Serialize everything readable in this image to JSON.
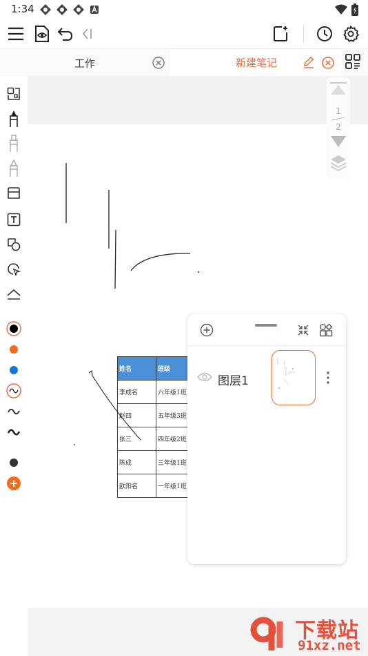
{
  "status_bar": {
    "time": "1:34"
  },
  "tabs": [
    {
      "label": "工作",
      "active": false
    },
    {
      "label": "新建笔记",
      "active": true
    }
  ],
  "colors": {
    "accent": "#e8693a",
    "palette": [
      "#000000",
      "#f46b1c",
      "#1577d4",
      "#000000",
      "#000000",
      "#333333"
    ],
    "table_header": "#4a90d9"
  },
  "page_nav": {
    "current": "1",
    "total": "2"
  },
  "table": {
    "headers": [
      "姓名",
      "班级"
    ],
    "rows": [
      [
        "李成名",
        "六年级1班"
      ],
      [
        "赵四",
        "五年级3班"
      ],
      [
        "张三",
        "四年级2班"
      ],
      [
        "陈成",
        "三年级1班"
      ],
      [
        "欧阳名",
        "一年级1班"
      ]
    ]
  },
  "layer_panel": {
    "layers": [
      {
        "name": "图层1",
        "selected": true
      }
    ]
  },
  "icons": {
    "toolbar": [
      "menu-icon",
      "preview-icon",
      "undo-icon",
      "collapse-icon",
      "add-page-icon",
      "history-icon",
      "settings-icon"
    ],
    "tools": [
      "select-icon",
      "pen-icon",
      "marker-icon",
      "highlighter-icon",
      "eraser-icon",
      "text-icon",
      "shape-icon",
      "lasso-icon",
      "ruler-icon"
    ]
  },
  "watermark": {
    "top": "下载站",
    "bottom": "91xz.net"
  }
}
